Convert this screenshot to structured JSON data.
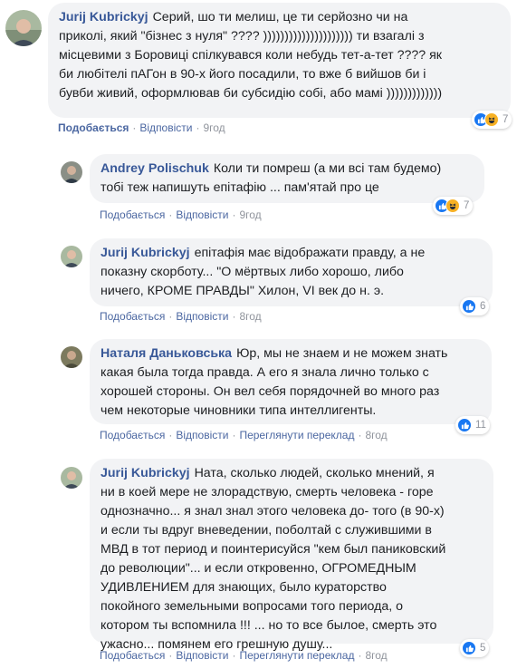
{
  "comments": [
    {
      "author": "Jurij Kubrickyj",
      "text": "Серий, шо ти мелиш, це ти серйозно чи на\nприколі, який \"бізнес з нуля\" ???? ))))))))))))))))))))) ти взагалі з\nмісцевими з Боровиці спілкувався коли небудь тет-а-тет ???? як\nби любітелі пАГон в 90-х його посадили, то вже б вийшов би і\nбувби живий, оформлював би субсидію собі, або мамі )))))))))))))",
      "like": "Подобається",
      "reply": "Відповісти",
      "time": "9год",
      "reactions": [
        "like-icon",
        "haha-icon"
      ],
      "count": "7"
    },
    {
      "author": "Andrey Polischuk",
      "text": "Коли ти помреш (а ми всі там будемо)\nтобі теж напишуть епітафію ... пам'ятай про це",
      "like": "Подобається",
      "reply": "Відповісти",
      "time": "9год",
      "reactions": [
        "like-icon",
        "haha-icon"
      ],
      "count": "7"
    },
    {
      "author": "Jurij Kubrickyj",
      "text": "епітафія має відображати правду, а не\nпоказну скорботу... \"О мёртвых либо хорошо, либо\nничего, КРОМЕ ПРАВДЫ\" Хилон, VI век до н. э.",
      "like": "Подобається",
      "reply": "Відповісти",
      "time": "8год",
      "reactions": [
        "like-icon"
      ],
      "count": "6"
    },
    {
      "author": "Наталя Даньковська",
      "text": "Юр, мы не знаем и не можем знать\nкакая была тогда правда. А его я знала лично только с\nхорошей стороны. Он вел себя порядочней во много раз\nчем некоторые чиновники типа интеллигенты.",
      "like": "Подобається",
      "reply": "Відповісти",
      "translate": "Переглянути переклад",
      "time": "8год",
      "reactions": [
        "like-icon"
      ],
      "count": "11"
    },
    {
      "author": "Jurij Kubrickyj",
      "text": "Ната, сколько людей, сколько мнений, я\nни в коей мере не злорадствую, смерть человека - горе\nоднозначно... я знал знал этого человека до- того (в 90-х)\nи если ты вдруг вневедении, поболтай с служившими в\nМВД в тот период и поинтерисуйся \"кем был паниковский\nдо революции\"... и если откровенно, ОГРОМЕДНЫМ\nУДИВЛЕНИЕМ для знающих, было кураторство\nпокойного земельными вопросами того периода, о\nкотором ты вспомнила !!! ... но то все былое, смерть это\nужасно... помянем его грешную душу...",
      "like": "Подобається",
      "reply": "Відповісти",
      "translate": "Переглянути переклад",
      "time": "8год",
      "reactions": [
        "like-icon"
      ],
      "count": "5"
    }
  ]
}
